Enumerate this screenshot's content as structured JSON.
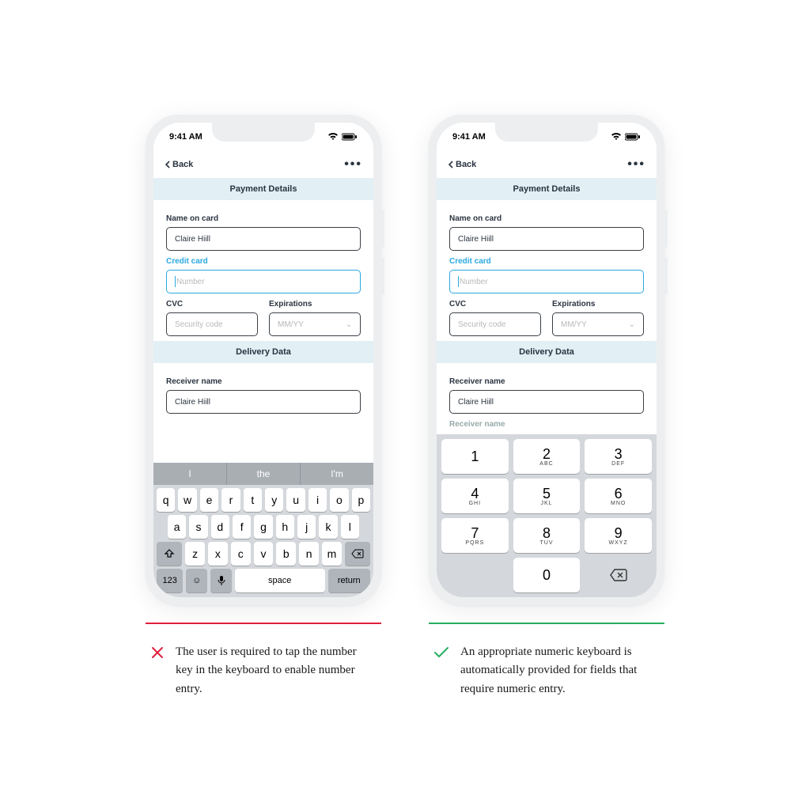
{
  "status": {
    "time": "9:41 AM"
  },
  "nav": {
    "back": "Back"
  },
  "sections": {
    "payment": "Payment Details",
    "delivery": "Delivery Data"
  },
  "form": {
    "name_label": "Name on card",
    "name_value": "Claire Hiill",
    "card_label": "Credit card",
    "card_placeholder": "Number",
    "cvc_label": "CVC",
    "cvc_placeholder": "Security code",
    "exp_label": "Expirations",
    "exp_placeholder": "MM/YY",
    "recv_label": "Receiver name",
    "recv_value": "Claire Hiill",
    "recv2_label": "Receiver name"
  },
  "qwerty": {
    "predict": [
      "I",
      "the",
      "I'm"
    ],
    "r1": [
      "q",
      "w",
      "e",
      "r",
      "t",
      "y",
      "u",
      "i",
      "o",
      "p"
    ],
    "r2": [
      "a",
      "s",
      "d",
      "f",
      "g",
      "h",
      "j",
      "k",
      "l"
    ],
    "r3": [
      "z",
      "x",
      "c",
      "v",
      "b",
      "n",
      "m"
    ],
    "num": "123",
    "space": "space",
    "ret": "return"
  },
  "numpad": [
    {
      "n": "1",
      "s": ""
    },
    {
      "n": "2",
      "s": "ABC"
    },
    {
      "n": "3",
      "s": "DEF"
    },
    {
      "n": "4",
      "s": "GHI"
    },
    {
      "n": "5",
      "s": "JKL"
    },
    {
      "n": "6",
      "s": "MNO"
    },
    {
      "n": "7",
      "s": "PQRS"
    },
    {
      "n": "8",
      "s": "TUV"
    },
    {
      "n": "9",
      "s": "WXYZ"
    },
    {
      "n": "",
      "s": ""
    },
    {
      "n": "0",
      "s": ""
    },
    {
      "n": "del",
      "s": ""
    }
  ],
  "captions": {
    "bad": "The user is required to tap the number key in the keyboard to enable number entry.",
    "good": "An appropriate numeric keyboard is automatically provided for fields that require numeric entry."
  }
}
